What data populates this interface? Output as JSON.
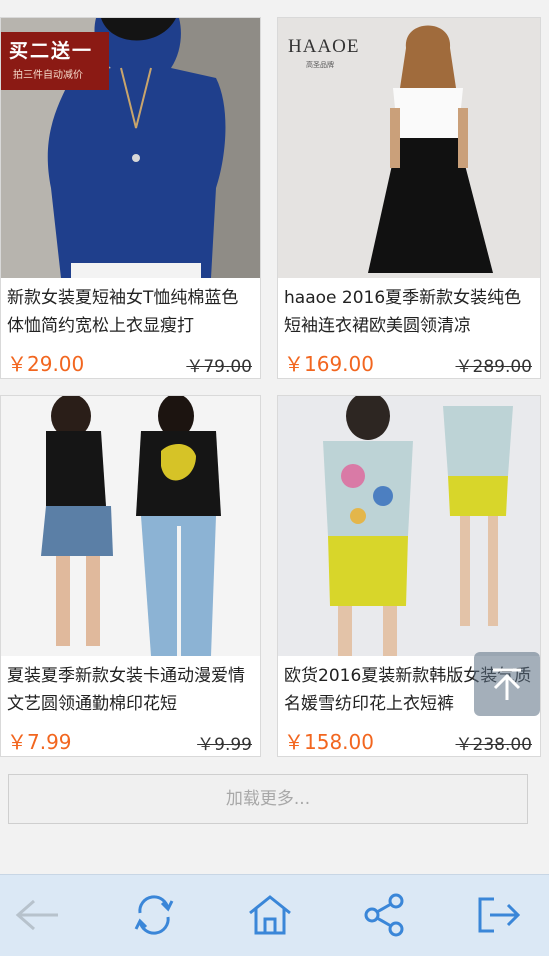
{
  "products": [
    {
      "title": "新款女装夏短袖女T恤纯棉蓝色体恤简约宽松上衣显瘦打",
      "price": "￥29.00",
      "original_price": "￥79.00",
      "image_overlay": {
        "badge_main": "买二送一",
        "badge_sub": "拍三件自动减价"
      }
    },
    {
      "title": "haaoe 2016夏季新款女装纯色短袖连衣裙欧美圆领清凉",
      "price": "￥169.00",
      "original_price": "￥289.00",
      "image_overlay": {
        "brand": "HAAOE",
        "brand_sub": "高圣品牌"
      }
    },
    {
      "title": "夏装夏季新款女装卡通动漫爱情文艺圆领通勤棉印花短",
      "price": "￥7.99",
      "original_price": "￥9.99"
    },
    {
      "title": "欧货2016夏装新款韩版女装气质名媛雪纺印花上衣短裤",
      "price": "￥158.00",
      "original_price": "￥238.00"
    }
  ],
  "load_more_label": "加载更多...",
  "toolbar": {
    "icons": [
      "back-arrow-icon",
      "refresh-icon",
      "home-icon",
      "share-icon",
      "exit-icon"
    ],
    "icon_color": "#3a86d8"
  },
  "colors": {
    "price": "#f2661f",
    "toolbar_bg": "#dbe8f5"
  }
}
